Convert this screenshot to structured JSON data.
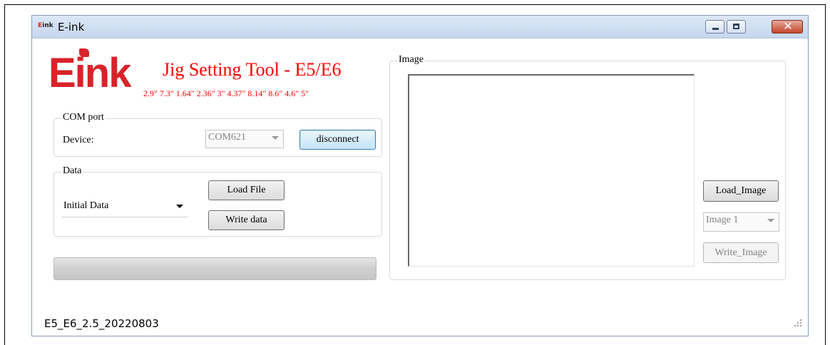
{
  "window": {
    "icon_text": "Eink",
    "title": "E-ink",
    "controls": {
      "minimize": "minimize-icon",
      "maximize": "maximize-icon",
      "close": "close-icon"
    }
  },
  "header": {
    "logo_text": "Eink",
    "app_title": "Jig Setting Tool - E5/E6",
    "sizes": "2.9\" 7.3\" 1.64\" 2.36\" 3\" 4.37\" 8.14\" 8.6\" 4.6\" 5\""
  },
  "com_port": {
    "legend": "COM port",
    "device_label": "Device:",
    "selected_port": "COM621",
    "disconnect_label": "disconnect"
  },
  "data_group": {
    "legend": "Data",
    "selected_data": "Initial Data",
    "load_file_label": "Load File",
    "write_data_label": "Write data"
  },
  "progress": {
    "value": 0
  },
  "image_group": {
    "legend": "Image",
    "load_image_label": "Load_Image",
    "selected_image": "Image 1",
    "write_image_label": "Write_Image"
  },
  "status": {
    "version": "E5_E6_2.5_20220803"
  },
  "colors": {
    "brand_red": "#d8232a",
    "title_red": "#ff0000",
    "focus_blue": "#3c7fb1"
  }
}
